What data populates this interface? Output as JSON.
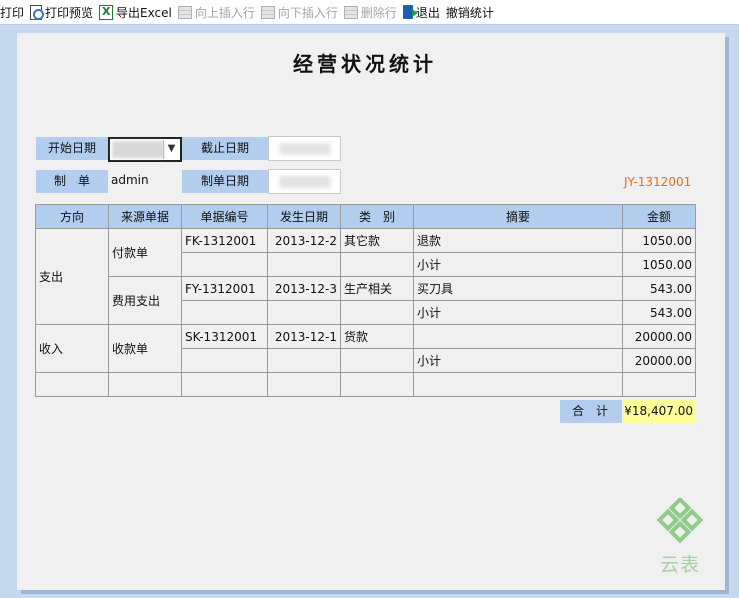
{
  "toolbar": {
    "print": "打印",
    "print_preview": "打印预览",
    "export_excel": "导出Excel",
    "insert_above": "向上插入行",
    "insert_below": "向下插入行",
    "delete_row": "删除行",
    "exit": "退出",
    "undo_stats": "撤销统计"
  },
  "form": {
    "title": "经营状况统计",
    "start_date_label": "开始日期",
    "end_date_label": "截止日期",
    "maker_label": "制　单",
    "maker_value": "admin",
    "make_date_label": "制单日期",
    "doc_no": "JY-1312001"
  },
  "table": {
    "headers": [
      "方向",
      "来源单据",
      "单据编号",
      "发生日期",
      "类　别",
      "摘要",
      "金额"
    ],
    "direction_groups": [
      "支出",
      "收入"
    ],
    "source_groups": [
      "付款单",
      "费用支出",
      "收款单"
    ],
    "rows": [
      {
        "doc_no": "FK-1312001",
        "date": "2013-12-2",
        "category": "其它款",
        "summary": "退款",
        "amount": "1050.00"
      },
      {
        "doc_no": "",
        "date": "",
        "category": "",
        "summary": "小计",
        "amount": "1050.00"
      },
      {
        "doc_no": "FY-1312001",
        "date": "2013-12-3",
        "category": "生产相关",
        "summary": "买刀具",
        "amount": "543.00"
      },
      {
        "doc_no": "",
        "date": "",
        "category": "",
        "summary": "小计",
        "amount": "543.00"
      },
      {
        "doc_no": "SK-1312001",
        "date": "2013-12-1",
        "category": "货款",
        "summary": "",
        "amount": "20000.00"
      },
      {
        "doc_no": "",
        "date": "",
        "category": "",
        "summary": "小计",
        "amount": "20000.00"
      }
    ]
  },
  "total": {
    "label": "合计",
    "value": "¥18,407.00"
  },
  "logo": {
    "text": "云表",
    "color": "#8fcc8a"
  }
}
